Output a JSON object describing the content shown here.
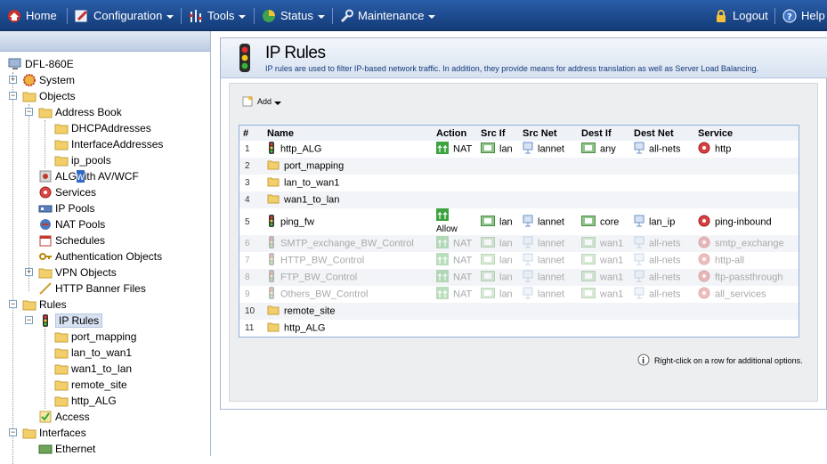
{
  "menu": {
    "home": "Home",
    "configuration": "Configuration",
    "tools": "Tools",
    "status": "Status",
    "maintenance": "Maintenance",
    "logout": "Logout",
    "help": "Help"
  },
  "tree": {
    "root": "DFL-860E",
    "system": "System",
    "objects": "Objects",
    "address_book": "Address Book",
    "dhcp_addresses": "DHCPAddresses",
    "interface_addresses": "InterfaceAddresses",
    "ip_pools_ab": "ip_pools",
    "alg_pre": "ALG ",
    "alg_hl": "w",
    "alg_post": "ith AV/WCF",
    "services": "Services",
    "ip_pools": "IP Pools",
    "nat_pools": "NAT Pools",
    "schedules": "Schedules",
    "auth_objects": "Authentication Objects",
    "vpn_objects": "VPN Objects",
    "http_banner": "HTTP Banner Files",
    "rules": "Rules",
    "ip_rules": "IP Rules",
    "port_mapping": "port_mapping",
    "lan_to_wan1": "lan_to_wan1",
    "wan1_to_lan": "wan1_to_lan",
    "remote_site": "remote_site",
    "http_alg": "http_ALG",
    "access": "Access",
    "interfaces": "Interfaces",
    "ethernet": "Ethernet"
  },
  "page": {
    "title": "IP Rules",
    "description": "IP rules are used to filter IP-based network traffic. In addition, they provide means for address translation as well as Server Load Balancing.",
    "add_label": "Add",
    "hint": "Right-click on a row for additional options."
  },
  "table": {
    "headers": [
      "#",
      "Name",
      "Action",
      "Src If",
      "Src Net",
      "Dest If",
      "Dest Net",
      "Service"
    ],
    "rows": [
      {
        "num": "1",
        "name": "http_ALG",
        "action": "NAT",
        "src_if": "lan",
        "src_net": "lannet",
        "dest_if": "any",
        "dest_net": "all-nets",
        "service": "http"
      },
      {
        "num": "2",
        "name": "port_mapping"
      },
      {
        "num": "3",
        "name": "lan_to_wan1"
      },
      {
        "num": "4",
        "name": "wan1_to_lan"
      },
      {
        "num": "5",
        "name": "ping_fw",
        "action": "Allow",
        "src_if": "lan",
        "src_net": "lannet",
        "dest_if": "core",
        "dest_net": "lan_ip",
        "service": "ping-inbound"
      },
      {
        "num": "6",
        "name": "SMTP_exchange_BW_Control",
        "action": "NAT",
        "src_if": "lan",
        "src_net": "lannet",
        "dest_if": "wan1",
        "dest_net": "all-nets",
        "service": "smtp_exchange"
      },
      {
        "num": "7",
        "name": "HTTP_BW_Control",
        "action": "NAT",
        "src_if": "lan",
        "src_net": "lannet",
        "dest_if": "wan1",
        "dest_net": "all-nets",
        "service": "http-all"
      },
      {
        "num": "8",
        "name": "FTP_BW_Control",
        "action": "NAT",
        "src_if": "lan",
        "src_net": "lannet",
        "dest_if": "wan1",
        "dest_net": "all-nets",
        "service": "ftp-passthrough"
      },
      {
        "num": "9",
        "name": "Others_BW_Control",
        "action": "NAT",
        "src_if": "lan",
        "src_net": "lannet",
        "dest_if": "wan1",
        "dest_net": "all-nets",
        "service": "all_services"
      },
      {
        "num": "10",
        "name": "remote_site"
      },
      {
        "num": "11",
        "name": "http_ALG"
      }
    ]
  },
  "colors": {
    "menubar": "#1d4a8e",
    "title_text": "#163c7a",
    "table_border": "#8fb0da",
    "disabled_text": "#a9a9a9"
  }
}
